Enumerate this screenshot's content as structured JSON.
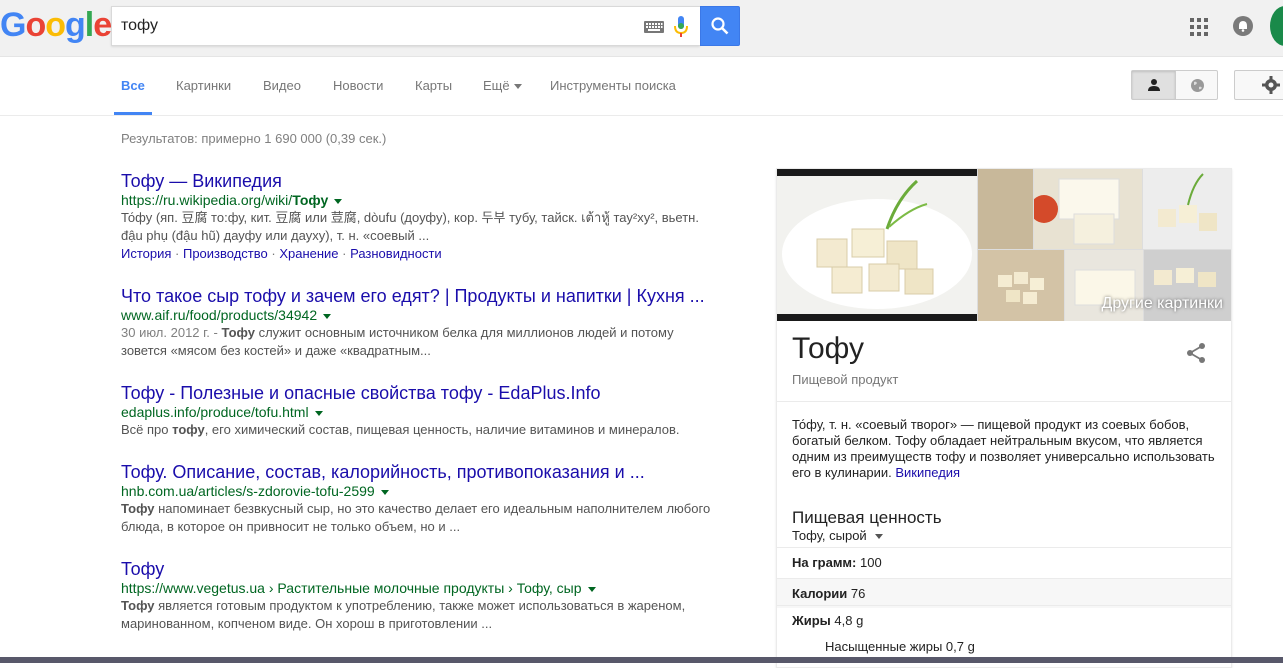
{
  "header": {
    "logo": [
      "G",
      "o",
      "o",
      "g",
      "l",
      "e"
    ],
    "logo_colors": [
      "#4285f4",
      "#ea4335",
      "#fbbc05",
      "#4285f4",
      "#34a853",
      "#ea4335"
    ],
    "search_value": "тофу"
  },
  "tabs": {
    "items": [
      "Все",
      "Картинки",
      "Видео",
      "Новости",
      "Карты",
      "Ещё",
      "Инструменты поиска"
    ]
  },
  "stats": "Результатов: примерно 1 690 000 (0,39 сек.)",
  "results": [
    {
      "title": "Тофу — Википедия",
      "url_prefix": "https://ru.wikipedia.org/wiki/",
      "url_bold": "Тофу",
      "snippet": "То́фу (яп. 豆腐 то:фу, кит. 豆腐 или 荳腐, dòufu (доуфу), кор. 두부 тубу, тайск. เต้าหู้ тау²ху², вьетн. đậu phụ (đậu hũ) дауфу или дауху), т. н. «соевый ...",
      "links": [
        "История",
        "Производство",
        "Хранение",
        "Разновидности"
      ]
    },
    {
      "title": "Что такое сыр тофу и зачем его едят? | Продукты и напитки | Кухня ...",
      "url_prefix": "www.aif.ru/food/products/34942",
      "url_bold": "",
      "snippet_date": "30 июл. 2012 г. - ",
      "snippet_bold": "Тофу",
      "snippet": " служит основным источником белка для миллионов людей и потому зовется «мясом без костей» и даже «квадратным..."
    },
    {
      "title": "Тофу - Полезные и опасные свойства тофу - EdaPlus.Info",
      "url_prefix": "edaplus.info/produce/tofu.html",
      "url_bold": "",
      "snippet_pre": "Всё про ",
      "snippet_bold": "тофу",
      "snippet": ", его химический состав, пищевая ценность, наличие витаминов и минералов."
    },
    {
      "title": "Тофу. Описание, состав, калорийность, противопоказания и ...",
      "url_prefix": "hnb.com.ua/articles/s-zdorovie-tofu-2599",
      "url_bold": "",
      "snippet_bold": "Тофу",
      "snippet": " напоминает безвкусный сыр, но это качество делает его идеальным наполнителем любого блюда, в которое он привносит не только объем, но и ..."
    },
    {
      "title": "Тофу",
      "url_prefix": "https://www.vegetus.ua › Растительные молочные продукты › Тофу, сыр",
      "url_bold": "",
      "snippet_bold": "Тофу",
      "snippet": " является готовым продуктом к употреблению, также может использоваться в жареном, маринованном, копченом виде. Он хорош в приготовлении ..."
    }
  ],
  "knowledge_panel": {
    "more_images": "Другие картинки",
    "title": "Тофу",
    "subtitle": "Пищевой продукт",
    "description": "То́фу, т. н. «соевый творог» — пищевой продукт из соевых бобов, богатый белком. Тофу обладает нейтральным вкусом, что является одним из преимуществ тофу и позволяет универсально использовать его в кулинарии.",
    "description_link": "Википедия",
    "nutrition_heading": "Пищевая ценность",
    "nutrition_select": "Тофу, сырой",
    "rows": [
      {
        "label": "На грамм:",
        "value": "100"
      },
      {
        "label": "Калории",
        "value": "76"
      },
      {
        "label": "Жиры",
        "value": "4,8 g"
      },
      {
        "label": "",
        "value": "Насыщенные жиры 0,7 g"
      }
    ]
  }
}
